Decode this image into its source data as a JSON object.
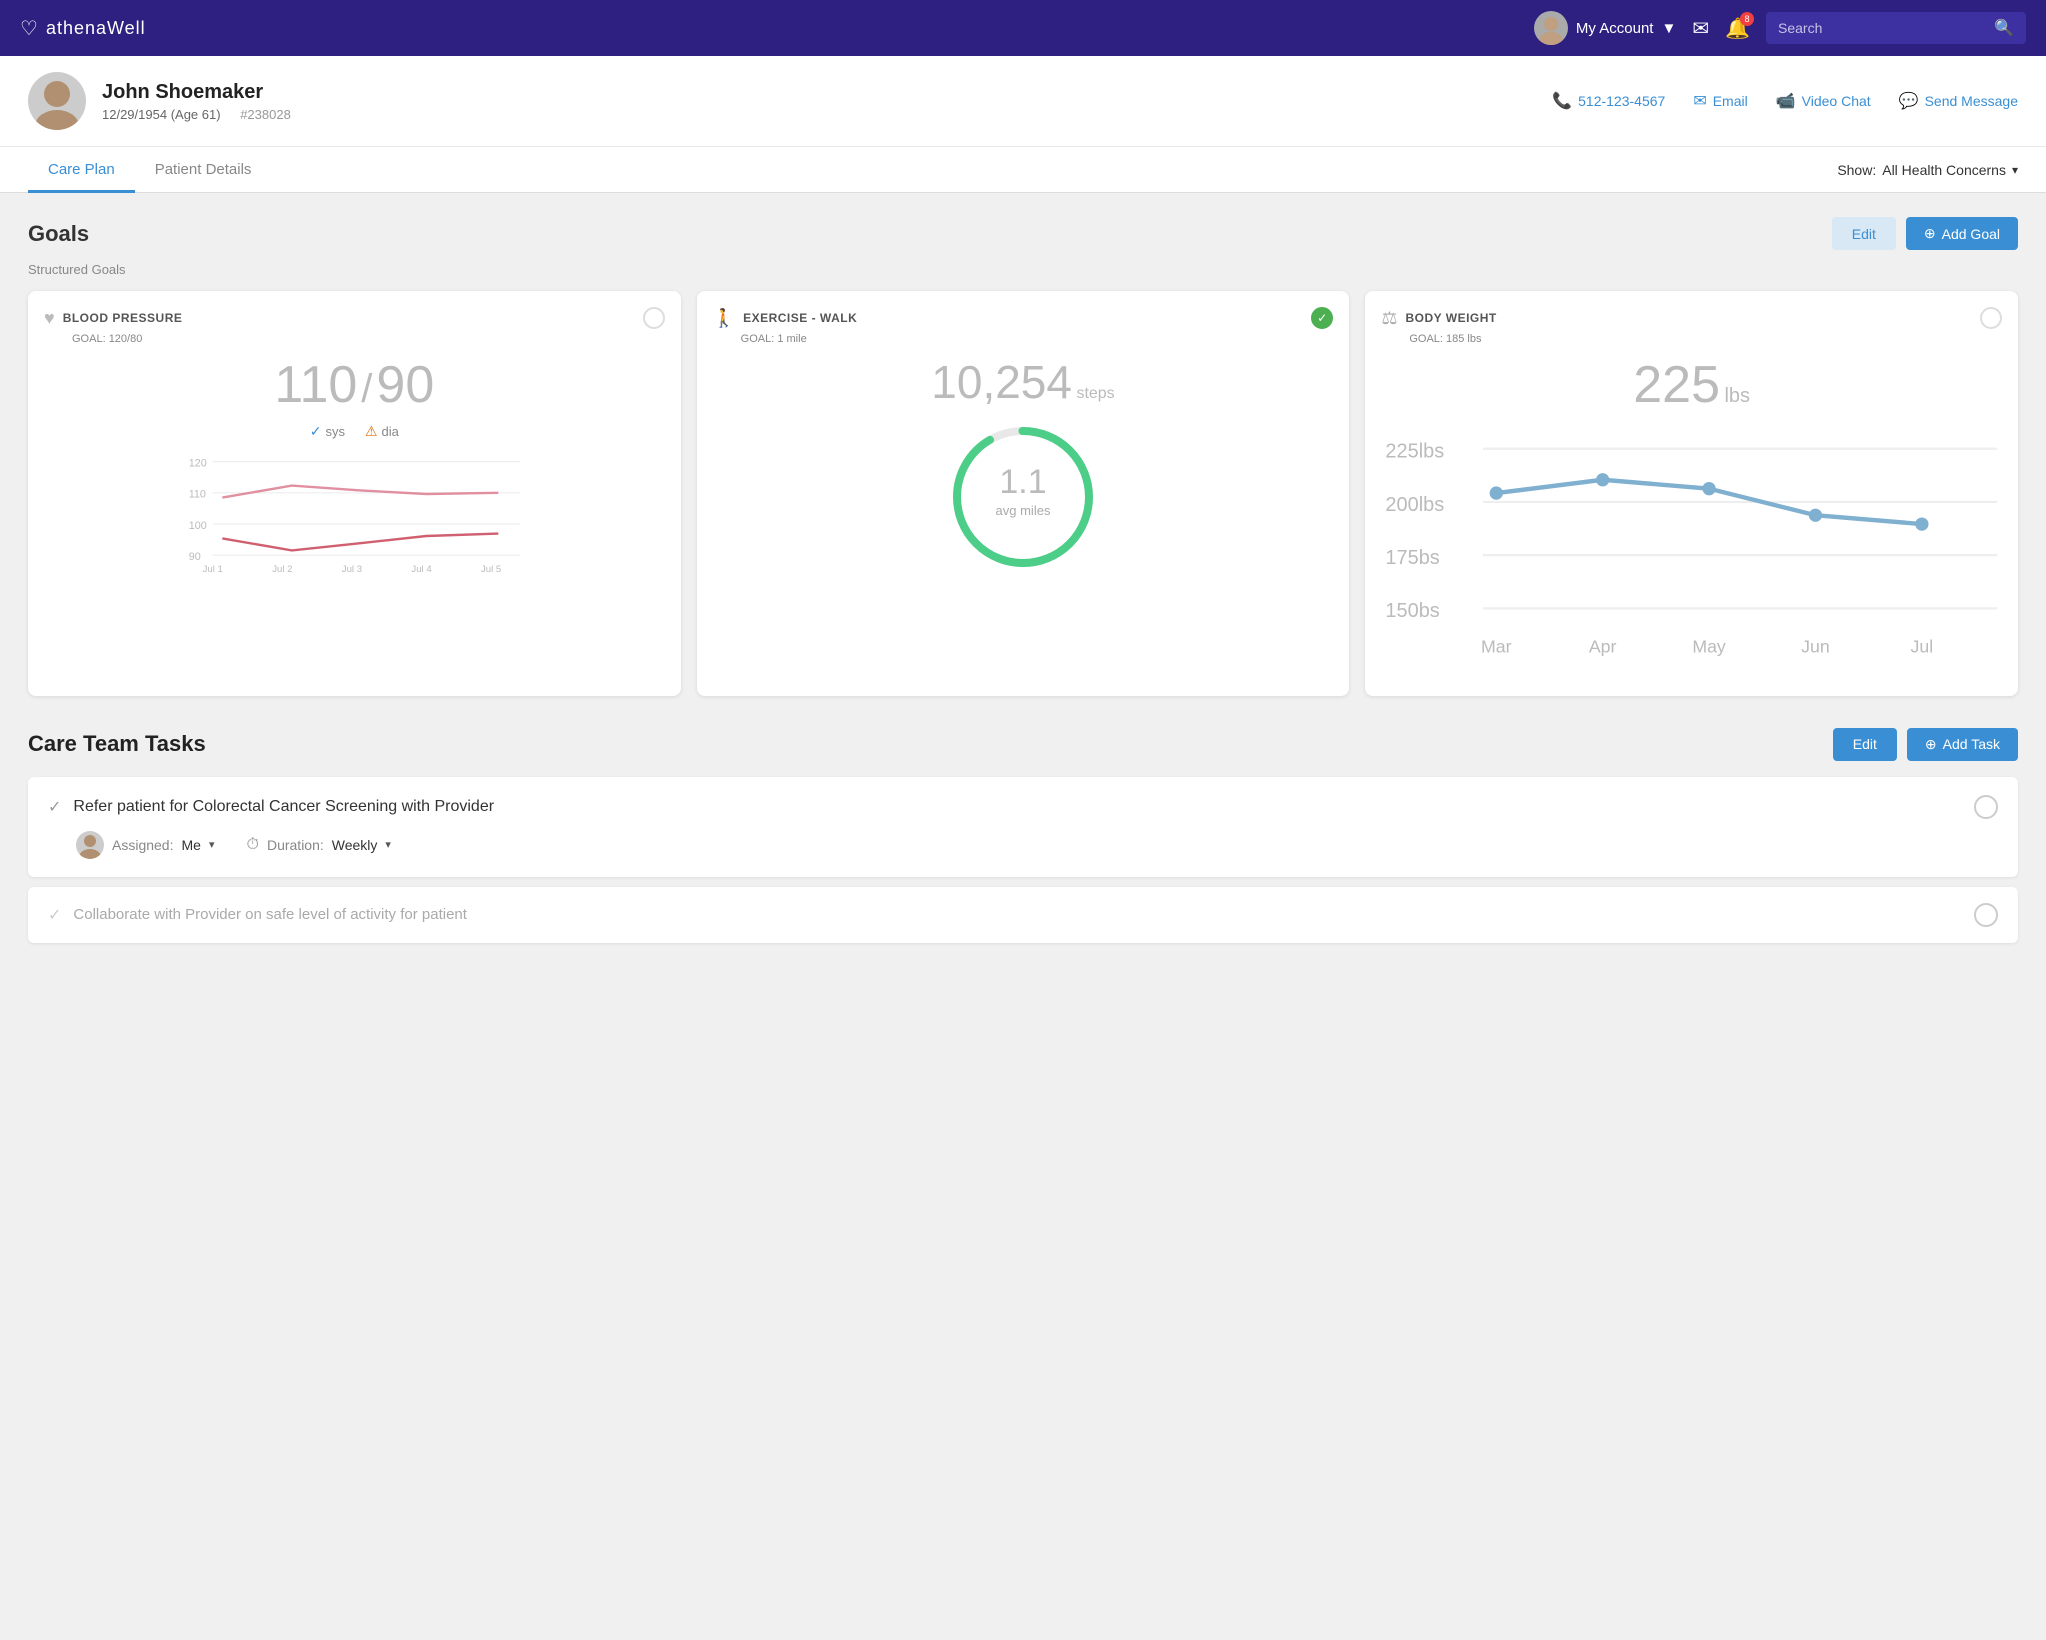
{
  "app": {
    "name": "athenaWell",
    "logo_icon": "♡"
  },
  "header": {
    "my_account_label": "My Account",
    "search_placeholder": "Search",
    "notification_count": "8"
  },
  "patient": {
    "name": "John Shoemaker",
    "dob": "12/29/1954",
    "age": "Age 61",
    "id": "#238028",
    "phone": "512-123-4567",
    "email_label": "Email",
    "video_chat_label": "Video Chat",
    "send_message_label": "Send Message"
  },
  "tabs": {
    "care_plan": "Care Plan",
    "patient_details": "Patient Details",
    "show_label": "Show:",
    "filter_value": "All Health Concerns"
  },
  "goals": {
    "section_title": "Goals",
    "edit_label": "Edit",
    "add_goal_label": "Add Goal",
    "structured_goals_label": "Structured Goals",
    "cards": [
      {
        "title": "BLOOD PRESSURE",
        "goal_label": "GOAL:",
        "goal_value": "120/80",
        "reading_sys": "110",
        "reading_dia": "90",
        "sys_label": "sys",
        "dia_label": "dia",
        "sys_status": "ok",
        "dia_status": "warn",
        "chart_y_labels": [
          "120",
          "110",
          "100",
          "90"
        ],
        "chart_x_labels": [
          "Jul 1",
          "Jul 2",
          "Jul 3",
          "Jul 4",
          "Jul 5"
        ],
        "achieved": false
      },
      {
        "title": "EXERCISE - WALK",
        "goal_label": "GOAL:",
        "goal_value": "1 mile",
        "reading": "10,254",
        "unit": "steps",
        "avg_value": "1.1",
        "avg_label": "avg miles",
        "achieved": true
      },
      {
        "title": "BODY WEIGHT",
        "goal_label": "GOAL:",
        "goal_value": "185 lbs",
        "reading": "225",
        "unit": "lbs",
        "chart_y_labels": [
          "225lbs",
          "200lbs",
          "175bs",
          "150bs"
        ],
        "chart_x_labels": [
          "Mar",
          "Apr",
          "May",
          "Jun",
          "Jul"
        ],
        "achieved": false
      }
    ]
  },
  "care_team_tasks": {
    "section_title": "Care Team Tasks",
    "edit_label": "Edit",
    "add_task_label": "Add Task",
    "tasks": [
      {
        "text": "Refer patient for Colorectal Cancer Screening with Provider",
        "assigned_label": "Assigned:",
        "assigned_value": "Me",
        "duration_label": "Duration:",
        "duration_value": "Weekly",
        "active": true
      },
      {
        "text": "Collaborate with Provider on safe level of activity for patient",
        "active": false
      }
    ]
  }
}
